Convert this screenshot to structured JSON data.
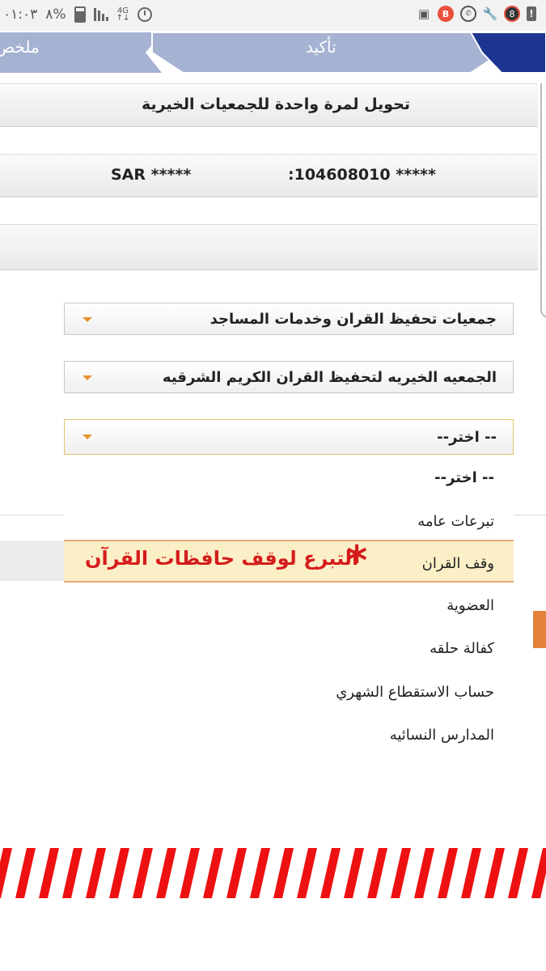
{
  "status_bar": {
    "time": "٠١:٠٣",
    "battery": "%٨",
    "network": "4G",
    "notification_count": "8",
    "badge_b": "B"
  },
  "steps": [
    {
      "label": "ملخص",
      "state": "inactive"
    },
    {
      "label": "تأكيد",
      "state": "inactive"
    },
    {
      "label": "",
      "state": "active"
    }
  ],
  "colors": {
    "step_inactive": "#a6b2d2",
    "step_active": "#1d3591",
    "annotation": "#d51c1c",
    "highlight": "#fbefc7",
    "accent_orange": "#e3823a"
  },
  "page": {
    "title": "تحويل لمرة واحدة للجمعيات الخيرية",
    "account": {
      "number": ":104608010 *****",
      "currency": "SAR *****"
    }
  },
  "form": {
    "category": "جمعيات تحفيظ القران وخدمات المساجد",
    "charity": "الجمعيه الخيريه لتحفيظ القران الكريم الشرقيه",
    "purpose": "-- اختر--"
  },
  "purpose_options": [
    "-- اختر--",
    "تبرعات عامه",
    "وقف القران",
    "العضوية",
    "كفالة حلقه",
    "حساب الاستقطاع الشهري",
    "المدارس النسائيه"
  ],
  "annotation": {
    "text": "التبرع لوقف حافظات القرآن",
    "mark": "*"
  }
}
